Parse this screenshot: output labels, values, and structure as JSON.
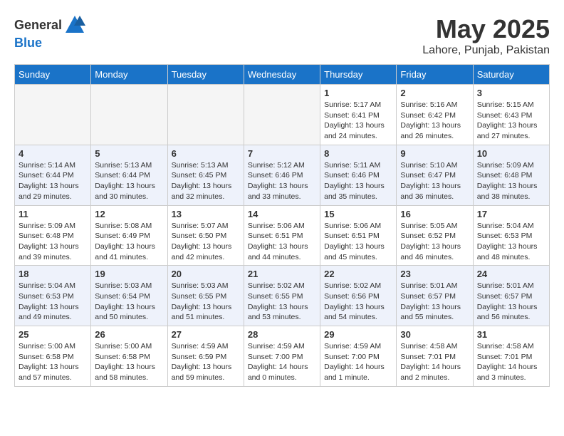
{
  "header": {
    "logo_general": "General",
    "logo_blue": "Blue",
    "month_year": "May 2025",
    "location": "Lahore, Punjab, Pakistan"
  },
  "days_of_week": [
    "Sunday",
    "Monday",
    "Tuesday",
    "Wednesday",
    "Thursday",
    "Friday",
    "Saturday"
  ],
  "weeks": [
    [
      {
        "day": "",
        "info": ""
      },
      {
        "day": "",
        "info": ""
      },
      {
        "day": "",
        "info": ""
      },
      {
        "day": "",
        "info": ""
      },
      {
        "day": "1",
        "info": "Sunrise: 5:17 AM\nSunset: 6:41 PM\nDaylight: 13 hours\nand 24 minutes."
      },
      {
        "day": "2",
        "info": "Sunrise: 5:16 AM\nSunset: 6:42 PM\nDaylight: 13 hours\nand 26 minutes."
      },
      {
        "day": "3",
        "info": "Sunrise: 5:15 AM\nSunset: 6:43 PM\nDaylight: 13 hours\nand 27 minutes."
      }
    ],
    [
      {
        "day": "4",
        "info": "Sunrise: 5:14 AM\nSunset: 6:44 PM\nDaylight: 13 hours\nand 29 minutes."
      },
      {
        "day": "5",
        "info": "Sunrise: 5:13 AM\nSunset: 6:44 PM\nDaylight: 13 hours\nand 30 minutes."
      },
      {
        "day": "6",
        "info": "Sunrise: 5:13 AM\nSunset: 6:45 PM\nDaylight: 13 hours\nand 32 minutes."
      },
      {
        "day": "7",
        "info": "Sunrise: 5:12 AM\nSunset: 6:46 PM\nDaylight: 13 hours\nand 33 minutes."
      },
      {
        "day": "8",
        "info": "Sunrise: 5:11 AM\nSunset: 6:46 PM\nDaylight: 13 hours\nand 35 minutes."
      },
      {
        "day": "9",
        "info": "Sunrise: 5:10 AM\nSunset: 6:47 PM\nDaylight: 13 hours\nand 36 minutes."
      },
      {
        "day": "10",
        "info": "Sunrise: 5:09 AM\nSunset: 6:48 PM\nDaylight: 13 hours\nand 38 minutes."
      }
    ],
    [
      {
        "day": "11",
        "info": "Sunrise: 5:09 AM\nSunset: 6:48 PM\nDaylight: 13 hours\nand 39 minutes."
      },
      {
        "day": "12",
        "info": "Sunrise: 5:08 AM\nSunset: 6:49 PM\nDaylight: 13 hours\nand 41 minutes."
      },
      {
        "day": "13",
        "info": "Sunrise: 5:07 AM\nSunset: 6:50 PM\nDaylight: 13 hours\nand 42 minutes."
      },
      {
        "day": "14",
        "info": "Sunrise: 5:06 AM\nSunset: 6:51 PM\nDaylight: 13 hours\nand 44 minutes."
      },
      {
        "day": "15",
        "info": "Sunrise: 5:06 AM\nSunset: 6:51 PM\nDaylight: 13 hours\nand 45 minutes."
      },
      {
        "day": "16",
        "info": "Sunrise: 5:05 AM\nSunset: 6:52 PM\nDaylight: 13 hours\nand 46 minutes."
      },
      {
        "day": "17",
        "info": "Sunrise: 5:04 AM\nSunset: 6:53 PM\nDaylight: 13 hours\nand 48 minutes."
      }
    ],
    [
      {
        "day": "18",
        "info": "Sunrise: 5:04 AM\nSunset: 6:53 PM\nDaylight: 13 hours\nand 49 minutes."
      },
      {
        "day": "19",
        "info": "Sunrise: 5:03 AM\nSunset: 6:54 PM\nDaylight: 13 hours\nand 50 minutes."
      },
      {
        "day": "20",
        "info": "Sunrise: 5:03 AM\nSunset: 6:55 PM\nDaylight: 13 hours\nand 51 minutes."
      },
      {
        "day": "21",
        "info": "Sunrise: 5:02 AM\nSunset: 6:55 PM\nDaylight: 13 hours\nand 53 minutes."
      },
      {
        "day": "22",
        "info": "Sunrise: 5:02 AM\nSunset: 6:56 PM\nDaylight: 13 hours\nand 54 minutes."
      },
      {
        "day": "23",
        "info": "Sunrise: 5:01 AM\nSunset: 6:57 PM\nDaylight: 13 hours\nand 55 minutes."
      },
      {
        "day": "24",
        "info": "Sunrise: 5:01 AM\nSunset: 6:57 PM\nDaylight: 13 hours\nand 56 minutes."
      }
    ],
    [
      {
        "day": "25",
        "info": "Sunrise: 5:00 AM\nSunset: 6:58 PM\nDaylight: 13 hours\nand 57 minutes."
      },
      {
        "day": "26",
        "info": "Sunrise: 5:00 AM\nSunset: 6:58 PM\nDaylight: 13 hours\nand 58 minutes."
      },
      {
        "day": "27",
        "info": "Sunrise: 4:59 AM\nSunset: 6:59 PM\nDaylight: 13 hours\nand 59 minutes."
      },
      {
        "day": "28",
        "info": "Sunrise: 4:59 AM\nSunset: 7:00 PM\nDaylight: 14 hours\nand 0 minutes."
      },
      {
        "day": "29",
        "info": "Sunrise: 4:59 AM\nSunset: 7:00 PM\nDaylight: 14 hours\nand 1 minute."
      },
      {
        "day": "30",
        "info": "Sunrise: 4:58 AM\nSunset: 7:01 PM\nDaylight: 14 hours\nand 2 minutes."
      },
      {
        "day": "31",
        "info": "Sunrise: 4:58 AM\nSunset: 7:01 PM\nDaylight: 14 hours\nand 3 minutes."
      }
    ]
  ]
}
